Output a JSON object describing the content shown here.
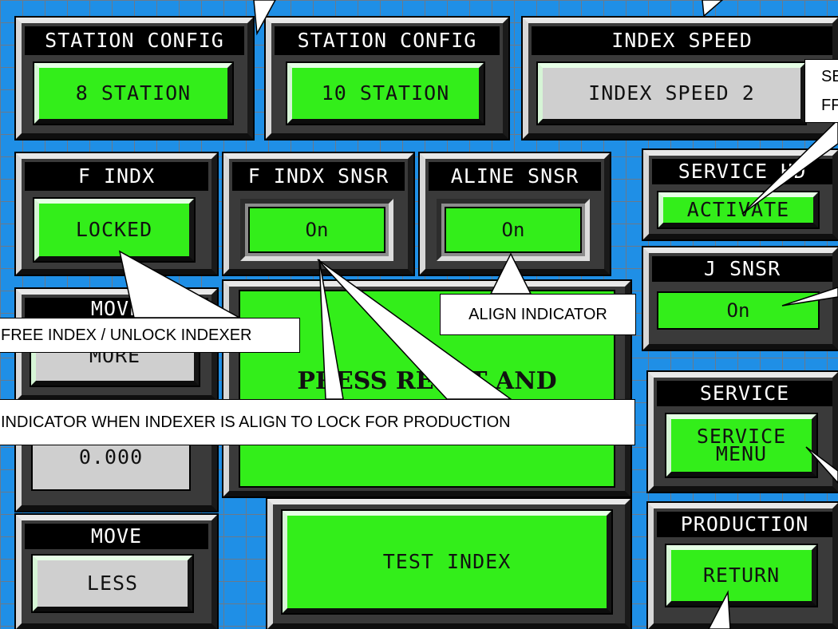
{
  "station_config_8": {
    "title": "STATION CONFIG",
    "button": "8 STATION"
  },
  "station_config_10": {
    "title": "STATION CONFIG",
    "button": "10 STATION"
  },
  "index_speed": {
    "title": "INDEX SPEED",
    "button": "INDEX SPEED 2"
  },
  "free_index": {
    "title": "F INDX",
    "button": "LOCKED"
  },
  "free_index_sensor": {
    "title": "F INDX SNSR",
    "value": "On"
  },
  "align_sensor": {
    "title": "ALINE SNSR",
    "value": "On"
  },
  "service_hd": {
    "title": "SERVICE HD",
    "button": "ACTIVATE"
  },
  "j_sensor": {
    "title": "J SNSR",
    "value": "On"
  },
  "move_more": {
    "title": "MOVE",
    "button": "MORE"
  },
  "position_readout": {
    "value": "0.000"
  },
  "message": {
    "text": "PRESS RESET AND"
  },
  "move_less": {
    "title": "MOVE",
    "button": "LESS"
  },
  "test_index": {
    "button": "TEST INDEX"
  },
  "service": {
    "title": "SERVICE",
    "button_line1": "SERVICE",
    "button_line2": "MENU"
  },
  "production": {
    "title": "PRODUCTION",
    "button": "RETURN"
  },
  "callouts": {
    "free_index": "FREE INDEX / UNLOCK INDEXER",
    "align_indicator": "ALIGN INDICATOR",
    "indexer_aligned": "INDICATOR WHEN INDEXER IS ALIGN TO LOCK FOR PRODUCTION",
    "service_partial_1": "SE",
    "service_partial_2": "FF"
  },
  "colors": {
    "button_green": "#33ee1a",
    "button_grey": "#cfcfcf",
    "background": "#1f8fe6"
  }
}
